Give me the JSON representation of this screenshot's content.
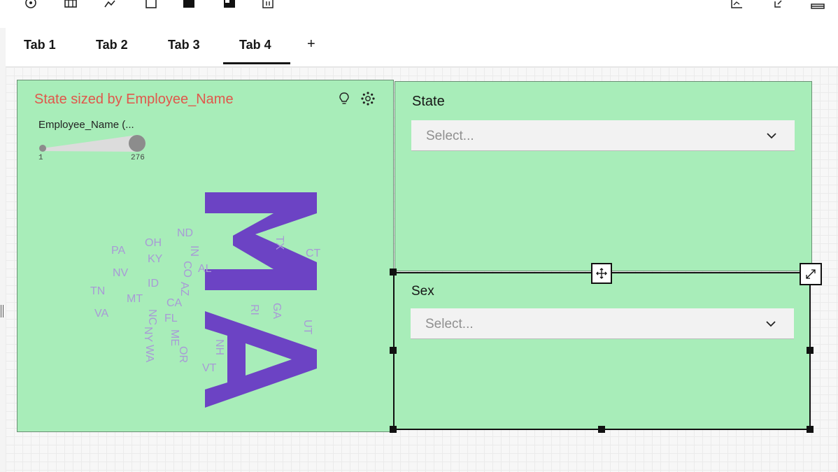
{
  "toolbar": {
    "icons": [
      "target-icon",
      "table-icon",
      "line-chart-icon",
      "square-icon",
      "fill-panel-icon",
      "panel-icon",
      "calendar-icon",
      "chart-icon",
      "share-icon",
      "collapse-icon"
    ]
  },
  "tabs": [
    {
      "label": "Tab 1"
    },
    {
      "label": "Tab 2"
    },
    {
      "label": "Tab 3"
    },
    {
      "label": "Tab 4",
      "active": true
    }
  ],
  "add_tab_label": "+",
  "wordcloud": {
    "title": "State sized by Employee_Name",
    "legend": {
      "title": "Employee_Name (...",
      "min": "1",
      "max": "276"
    },
    "colors": {
      "title": "#e0574b",
      "big_word": "#6c43c4",
      "small_word": "#a89ad6",
      "panel_bg": "#a8edb9"
    }
  },
  "chart_data": {
    "type": "wordcloud",
    "title": "State sized by Employee_Name",
    "size_legend": {
      "label": "Employee_Name (...",
      "range": [
        1,
        276
      ]
    },
    "words": [
      {
        "text": "MA",
        "size": 276
      },
      {
        "text": "CT"
      },
      {
        "text": "TX"
      },
      {
        "text": "ND"
      },
      {
        "text": "OH"
      },
      {
        "text": "PA"
      },
      {
        "text": "IN"
      },
      {
        "text": "KY"
      },
      {
        "text": "CO"
      },
      {
        "text": "NV"
      },
      {
        "text": "AL"
      },
      {
        "text": "TN"
      },
      {
        "text": "ID"
      },
      {
        "text": "AZ"
      },
      {
        "text": "MT"
      },
      {
        "text": "CA"
      },
      {
        "text": "VA"
      },
      {
        "text": "RI"
      },
      {
        "text": "GA"
      },
      {
        "text": "NC"
      },
      {
        "text": "FL"
      },
      {
        "text": "UT"
      },
      {
        "text": "NY"
      },
      {
        "text": "ME"
      },
      {
        "text": "WA"
      },
      {
        "text": "OR"
      },
      {
        "text": "NH"
      },
      {
        "text": "VT"
      }
    ]
  },
  "state_filter": {
    "label": "State",
    "placeholder": "Select..."
  },
  "sex_filter": {
    "label": "Sex",
    "placeholder": "Select..."
  }
}
